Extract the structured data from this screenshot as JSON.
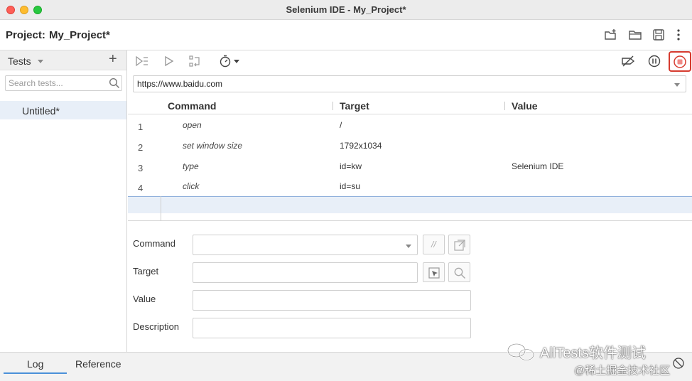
{
  "window": {
    "title": "Selenium IDE - My_Project*"
  },
  "project": {
    "label": "Project:",
    "name": "My_Project*"
  },
  "sidebar": {
    "header": "Tests",
    "add_label": "+",
    "search_placeholder": "Search tests...",
    "tests": [
      {
        "name": "Untitled*",
        "selected": true
      }
    ]
  },
  "toolbar": {
    "icons": [
      "run-all-icon",
      "run-icon",
      "step-icon",
      "speed-timer-icon",
      "disable-breakpoints-icon",
      "pause-icon",
      "stop-record-icon"
    ]
  },
  "url": {
    "value": "https://www.baidu.com"
  },
  "table": {
    "headers": {
      "command": "Command",
      "target": "Target",
      "value": "Value"
    },
    "rows": [
      {
        "num": "1",
        "command": "open",
        "target": "/",
        "value": ""
      },
      {
        "num": "2",
        "command": "set window size",
        "target": "1792x1034",
        "value": ""
      },
      {
        "num": "3",
        "command": "type",
        "target": "id=kw",
        "value": "Selenium IDE"
      },
      {
        "num": "4",
        "command": "click",
        "target": "id=su",
        "value": ""
      }
    ]
  },
  "editor": {
    "command_label": "Command",
    "target_label": "Target",
    "value_label": "Value",
    "description_label": "Description",
    "comment_glyph": "//"
  },
  "bottom": {
    "log_tab": "Log",
    "reference_tab": "Reference"
  },
  "watermark": {
    "line1": "AllTests软件测试",
    "line2": "@稀土掘金技术社区"
  },
  "colors": {
    "accent": "#4a90d9",
    "record_red": "#d63b2f",
    "selected_bg": "#e8eff8"
  }
}
